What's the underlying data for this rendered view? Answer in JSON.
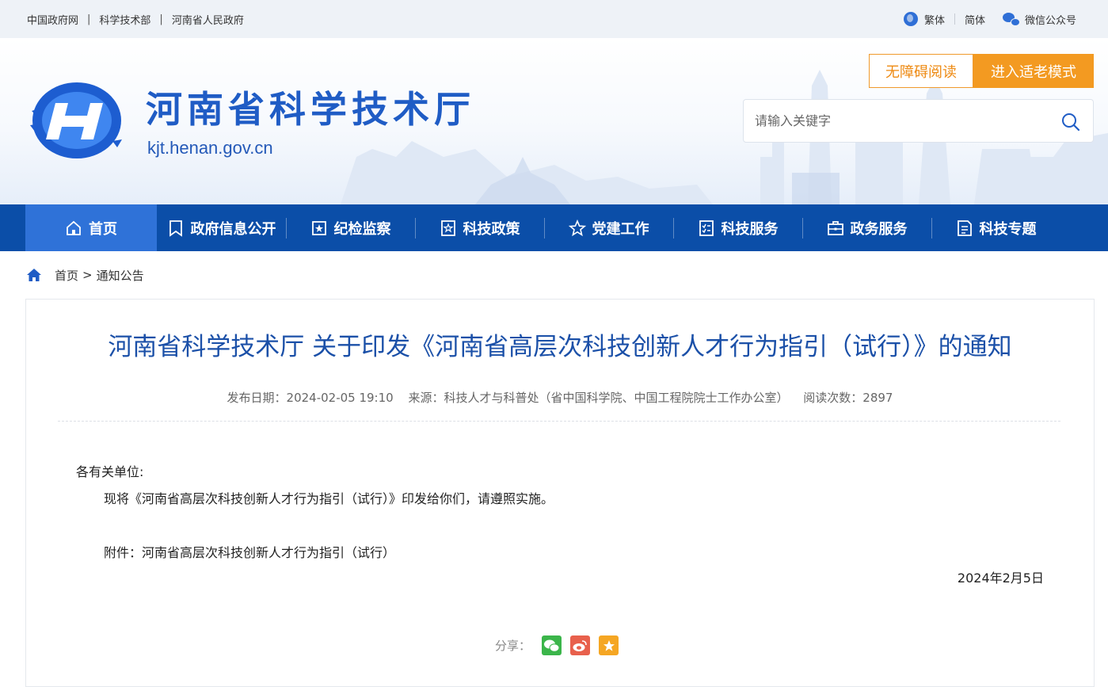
{
  "topbar": {
    "links": [
      "中国政府网",
      "科学技术部",
      "河南省人民政府"
    ],
    "separator": "|",
    "traditional": "繁体",
    "simplified": "简体",
    "wechat": "微信公众号"
  },
  "header": {
    "site_name": "河南省科学技术厅",
    "domain": "kjt.henan.gov.cn",
    "accessibility_button": "无障碍阅读",
    "elder_mode_button": "进入适老模式",
    "search_placeholder": "请输入关键字"
  },
  "nav": [
    {
      "label": "首页",
      "icon": "home-icon",
      "active": true
    },
    {
      "label": "政府信息公开",
      "icon": "bookmark-icon"
    },
    {
      "label": "纪检监察",
      "icon": "badge-icon"
    },
    {
      "label": "科技政策",
      "icon": "document-star-icon"
    },
    {
      "label": "党建工作",
      "icon": "star-icon"
    },
    {
      "label": "科技服务",
      "icon": "checklist-icon"
    },
    {
      "label": "政务服务",
      "icon": "briefcase-icon"
    },
    {
      "label": "科技专题",
      "icon": "file-list-icon"
    }
  ],
  "breadcrumb": {
    "home": "首页",
    "arrow": ">",
    "current": "通知公告"
  },
  "article": {
    "title": "河南省科学技术厅 关于印发《河南省高层次科技创新人才行为指引（试行）》的通知",
    "publish_date": "发布日期：2024-02-05 19:10",
    "source": "来源：科技人才与科普处（省中国科学院、中国工程院院士工作办公室）",
    "views": "阅读次数：2897",
    "salutation": "各有关单位:",
    "body": "现将《河南省高层次科技创新人才行为指引（试行）》印发给你们，请遵照实施。",
    "attachment": "附件：河南省高层次科技创新人才行为指引（试行）",
    "date": "2024年2月5日",
    "share_label": "分享："
  },
  "colors": {
    "brand_blue": "#0b4ea8",
    "nav_active": "#2f72d8",
    "title_blue": "#1b50a8",
    "orange": "#f39a21",
    "wechat_green": "#3bb54a",
    "weibo_red": "#e8604c",
    "favorite_yellow": "#f5a623"
  }
}
